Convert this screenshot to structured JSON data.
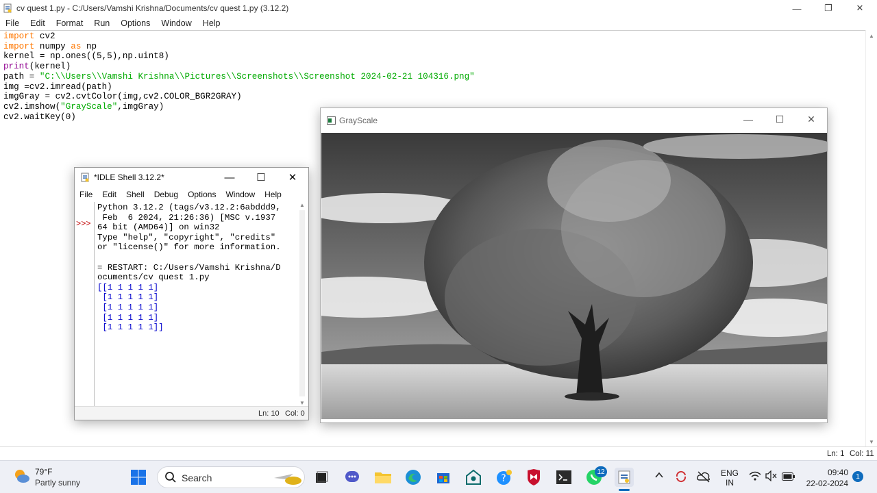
{
  "editor_window": {
    "title": "cv quest 1.py - C:/Users/Vamshi Krishna/Documents/cv quest 1.py (3.12.2)",
    "menu": [
      "File",
      "Edit",
      "Format",
      "Run",
      "Options",
      "Window",
      "Help"
    ],
    "code": [
      [
        {
          "t": "import",
          "c": "kw"
        },
        {
          "t": " cv2",
          "c": ""
        }
      ],
      [
        {
          "t": "import",
          "c": "kw"
        },
        {
          "t": " numpy ",
          "c": ""
        },
        {
          "t": "as",
          "c": "kw"
        },
        {
          "t": " np",
          "c": ""
        }
      ],
      [
        {
          "t": "kernel = np.ones((5,5),np.uint8)",
          "c": ""
        }
      ],
      [
        {
          "t": "print",
          "c": "bi"
        },
        {
          "t": "(kernel)",
          "c": ""
        }
      ],
      [
        {
          "t": "path = ",
          "c": ""
        },
        {
          "t": "\"C:\\\\Users\\\\Vamshi Krishna\\\\Pictures\\\\Screenshots\\\\Screenshot 2024-02-21 104316.png\"",
          "c": "st"
        }
      ],
      [
        {
          "t": "img =cv2.imread(path)",
          "c": ""
        }
      ],
      [
        {
          "t": "imgGray = cv2.cvtColor(img,cv2.COLOR_BGR2GRAY)",
          "c": ""
        }
      ],
      [
        {
          "t": "cv2.imshow(",
          "c": ""
        },
        {
          "t": "\"GrayScale\"",
          "c": "st"
        },
        {
          "t": ",imgGray)",
          "c": ""
        }
      ],
      [
        {
          "t": "cv2.waitKey(0)",
          "c": ""
        }
      ]
    ],
    "status_ln": "Ln: 1",
    "status_col": "Col: 11"
  },
  "shell_window": {
    "title": "*IDLE Shell 3.12.2*",
    "menu": [
      "File",
      "Edit",
      "Shell",
      "Debug",
      "Options",
      "Window",
      "Help"
    ],
    "prompt": ">>>",
    "output_lines": [
      {
        "t": "Python 3.12.2 (tags/v3.12.2:6abddd9,",
        "c": ""
      },
      {
        "t": " Feb  6 2024, 21:26:36) [MSC v.1937",
        "c": ""
      },
      {
        "t": "64 bit (AMD64)] on win32",
        "c": ""
      },
      {
        "t": "Type \"help\", \"copyright\", \"credits\"",
        "c": ""
      },
      {
        "t": "or \"license()\" for more information.",
        "c": ""
      },
      {
        "t": "",
        "c": ""
      },
      {
        "t": "= RESTART: C:/Users/Vamshi Krishna/D",
        "c": ""
      },
      {
        "t": "ocuments/cv quest 1.py",
        "c": ""
      },
      {
        "t": "[[1 1 1 1 1]",
        "c": "blue"
      },
      {
        "t": " [1 1 1 1 1]",
        "c": "blue"
      },
      {
        "t": " [1 1 1 1 1]",
        "c": "blue"
      },
      {
        "t": " [1 1 1 1 1]",
        "c": "blue"
      },
      {
        "t": " [1 1 1 1 1]]",
        "c": "blue"
      }
    ],
    "status_ln": "Ln: 10",
    "status_col": "Col: 0"
  },
  "grayscale_window": {
    "title": "GrayScale"
  },
  "taskbar": {
    "weather_temp": "79°F",
    "weather_desc": "Partly sunny",
    "search_label": "Search",
    "whatsapp_badge": "12",
    "lang_top": "ENG",
    "lang_bottom": "IN",
    "time": "09:40",
    "date": "22-02-2024",
    "notification_count": "1"
  },
  "colors": {
    "keyword": "#ff7700",
    "builtin": "#900090",
    "string": "#00aa00",
    "shell_output": "#0000cc",
    "prompt": "#c00000"
  }
}
